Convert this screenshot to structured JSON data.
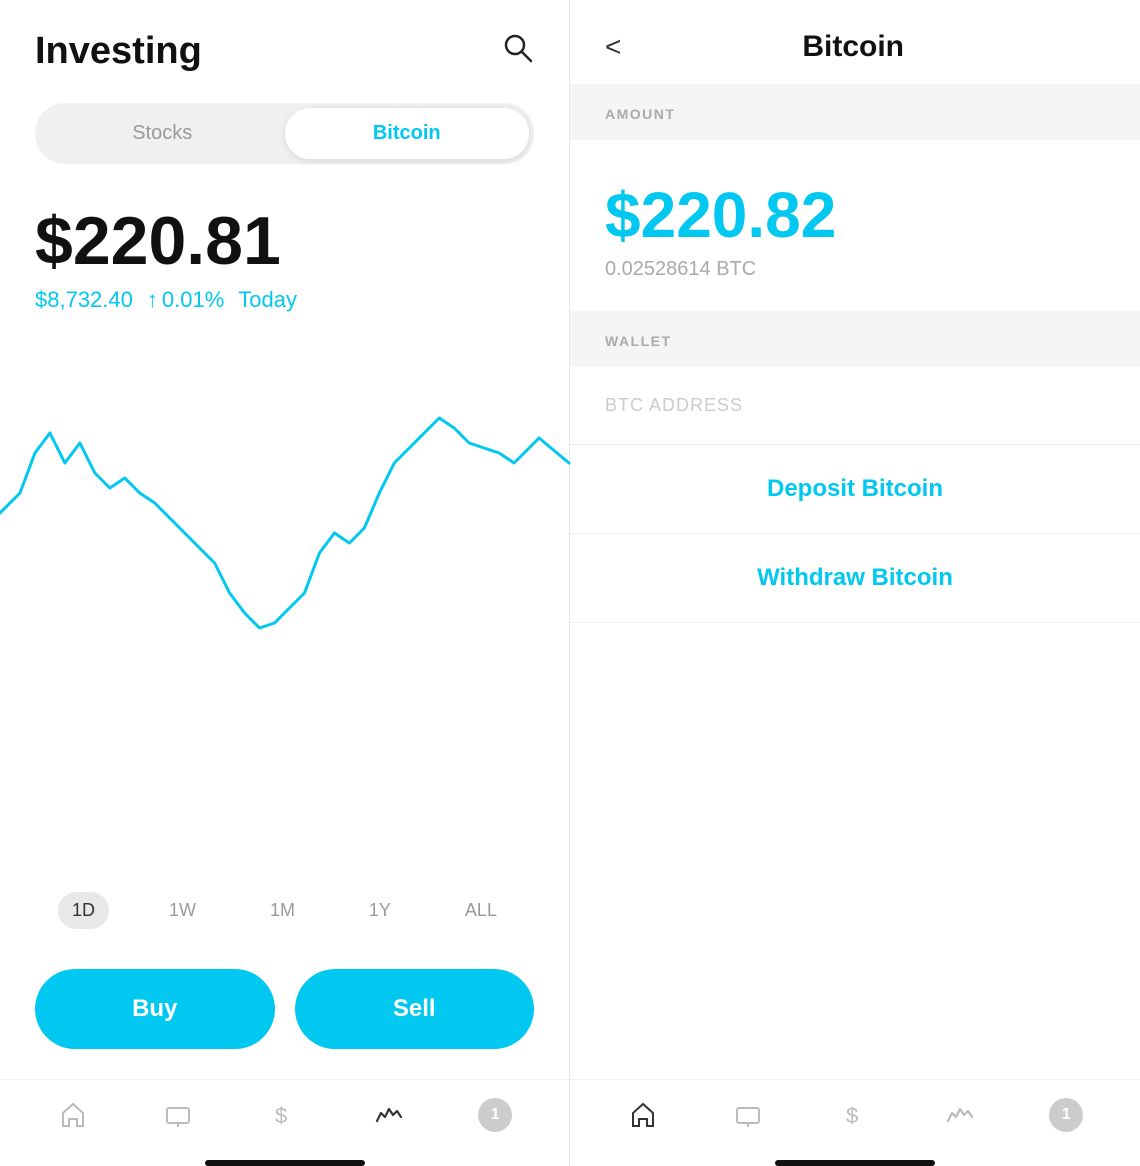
{
  "left": {
    "title": "Investing",
    "tabs": [
      {
        "label": "Stocks",
        "active": false
      },
      {
        "label": "Bitcoin",
        "active": true
      }
    ],
    "main_price": "$220.81",
    "btc_price": "$8,732.40",
    "change_arrow": "↑",
    "change_pct": "0.01%",
    "today_label": "Today",
    "time_filters": [
      {
        "label": "1D",
        "active": true
      },
      {
        "label": "1W",
        "active": false
      },
      {
        "label": "1M",
        "active": false
      },
      {
        "label": "1Y",
        "active": false
      },
      {
        "label": "ALL",
        "active": false
      }
    ],
    "buy_label": "Buy",
    "sell_label": "Sell",
    "nav_items": [
      {
        "icon": "home",
        "active": false
      },
      {
        "icon": "tv",
        "active": false
      },
      {
        "icon": "dollar",
        "active": false
      },
      {
        "icon": "chart",
        "active": true
      },
      {
        "icon": "badge",
        "label": "1",
        "active": false
      }
    ]
  },
  "right": {
    "back_label": "<",
    "title": "Bitcoin",
    "amount_label": "AMOUNT",
    "amount_value": "$220.82",
    "amount_btc": "0.02528614 BTC",
    "wallet_label": "WALLET",
    "btc_address_label": "BTC ADDRESS",
    "deposit_label": "Deposit Bitcoin",
    "withdraw_label": "Withdraw Bitcoin",
    "nav_items": [
      {
        "icon": "home",
        "active": true
      },
      {
        "icon": "tv",
        "active": false
      },
      {
        "icon": "dollar",
        "active": false
      },
      {
        "icon": "chart",
        "active": false
      },
      {
        "icon": "badge",
        "label": "1",
        "active": false
      }
    ]
  },
  "colors": {
    "accent": "#00c8f0",
    "text_dark": "#111111",
    "text_gray": "#aaaaaa",
    "bg_light": "#f5f5f5"
  }
}
